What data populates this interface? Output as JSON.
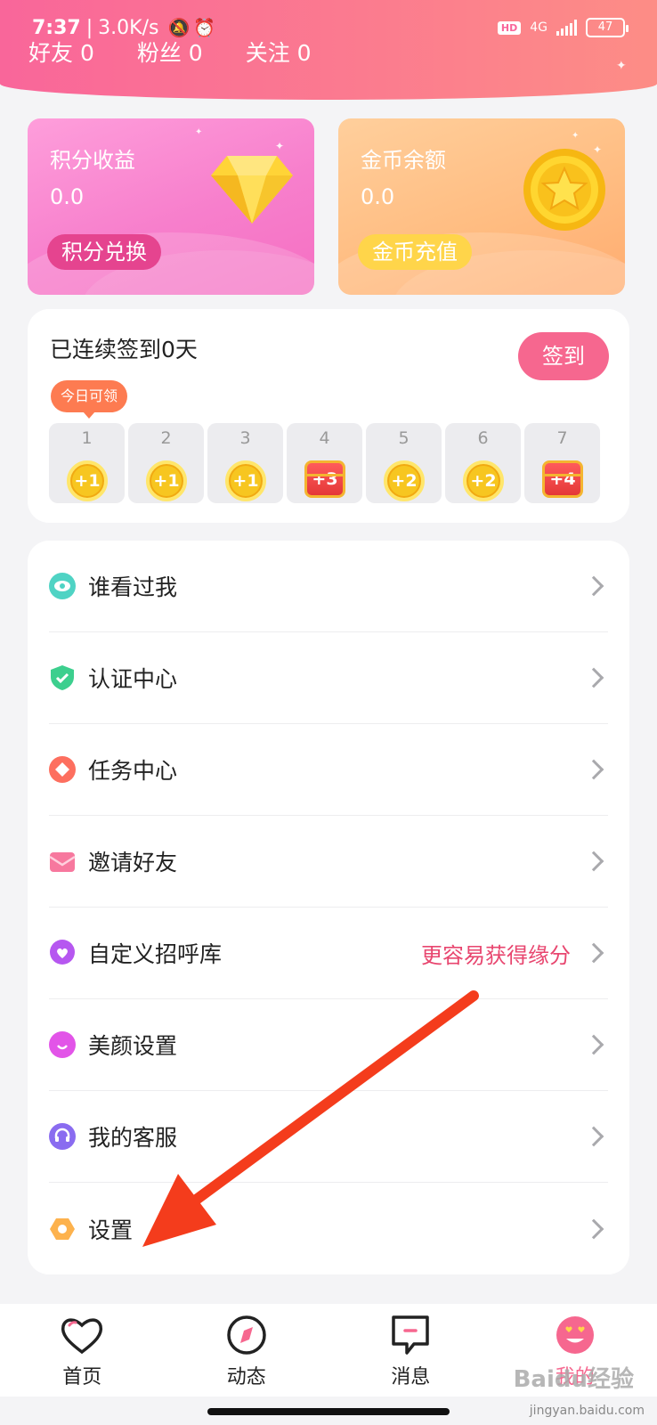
{
  "status_bar": {
    "time": "7:37",
    "network_speed": "3.0K/s",
    "hd_badge": "HD",
    "network_type": "4G",
    "battery": "47"
  },
  "social": [
    {
      "label": "好友 0"
    },
    {
      "label": "粉丝 0"
    },
    {
      "label": "关注 0"
    }
  ],
  "wallet": {
    "points": {
      "title": "积分收益",
      "value": "0.0",
      "button": "积分兑换",
      "icon": "diamond-icon"
    },
    "coins": {
      "title": "金币余额",
      "value": "0.0",
      "button": "金币充值",
      "icon": "star-coin-icon"
    }
  },
  "checkin": {
    "title": "已连续签到0天",
    "button": "签到",
    "today_tag": "今日可领",
    "days": [
      {
        "day": "1",
        "reward": "+1",
        "type": "coin"
      },
      {
        "day": "2",
        "reward": "+1",
        "type": "coin"
      },
      {
        "day": "3",
        "reward": "+1",
        "type": "coin"
      },
      {
        "day": "4",
        "reward": "+3",
        "type": "chest"
      },
      {
        "day": "5",
        "reward": "+2",
        "type": "coin"
      },
      {
        "day": "6",
        "reward": "+2",
        "type": "coin"
      },
      {
        "day": "7",
        "reward": "+4",
        "type": "chest"
      }
    ]
  },
  "menu": [
    {
      "label": "谁看过我",
      "icon": "eye-icon",
      "color": "#4fd3c4"
    },
    {
      "label": "认证中心",
      "icon": "shield-check-icon",
      "color": "#3ccf8e"
    },
    {
      "label": "任务中心",
      "icon": "diamond-task-icon",
      "color": "#fd6f5f"
    },
    {
      "label": "邀请好友",
      "icon": "envelope-icon",
      "color": "#f7789e"
    },
    {
      "label": "自定义招呼库",
      "icon": "heart-chat-icon",
      "color": "#b657f0",
      "hint": "更容易获得缘分"
    },
    {
      "label": "美颜设置",
      "icon": "smile-icon",
      "color": "#e254e8"
    },
    {
      "label": "我的客服",
      "icon": "headset-icon",
      "color": "#8a6cf0"
    },
    {
      "label": "设置",
      "icon": "gear-icon",
      "color": "#fdb24d"
    }
  ],
  "tabs": [
    {
      "label": "首页",
      "icon": "heart-outline-icon"
    },
    {
      "label": "动态",
      "icon": "compass-icon"
    },
    {
      "label": "消息",
      "icon": "chat-icon"
    },
    {
      "label": "我的",
      "icon": "emoji-face-icon",
      "active": true
    }
  ],
  "watermark": {
    "brand": "Baidu经验",
    "url": "jingyan.baidu.com"
  },
  "colors": {
    "accent": "#f6678f",
    "hint": "#e8466f",
    "annotation_arrow": "#f43c1c"
  }
}
